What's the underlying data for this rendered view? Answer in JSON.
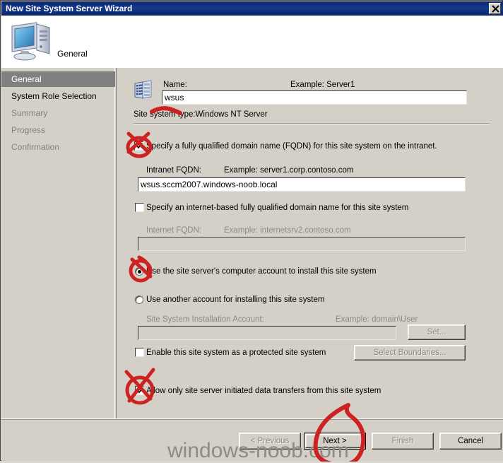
{
  "window": {
    "title": "New Site System Server Wizard",
    "close_label": "x"
  },
  "header": {
    "title": "General",
    "icon": "computer-server-icon"
  },
  "sidebar": {
    "items": [
      {
        "label": "General",
        "state": "active"
      },
      {
        "label": "System Role Selection",
        "state": "enabled"
      },
      {
        "label": "Summary",
        "state": "disabled"
      },
      {
        "label": "Progress",
        "state": "disabled"
      },
      {
        "label": "Confirmation",
        "state": "disabled"
      }
    ]
  },
  "main": {
    "name_label": "Name:",
    "name_example": "Example: Server1",
    "name_value": "wsus",
    "site_system_type": "Site system type:Windows NT Server",
    "fqdn_checkbox_label": "Specify a fully qualified domain name (FQDN) for this site system on the intranet.",
    "fqdn_checkbox_checked": true,
    "intranet_fqdn_label": "Intranet FQDN:",
    "intranet_fqdn_example": "Example: server1.corp.contoso.com",
    "intranet_fqdn_value": "wsus.sccm2007.windows-noob.local",
    "internet_checkbox_label": "Specify an internet-based fully qualified domain name for this site system",
    "internet_checkbox_checked": false,
    "internet_fqdn_label": "Internet FQDN:",
    "internet_fqdn_example": "Example: internetsrv2.contoso.com",
    "internet_fqdn_value": "",
    "radio_computer_account_label": "Use the site server's computer account to install this site system",
    "radio_computer_account_selected": true,
    "radio_another_account_label": "Use another account for installing this site system",
    "radio_another_account_selected": false,
    "install_account_label": "Site System Installation Account:",
    "install_account_example": "Example: domain\\User",
    "install_account_value": "",
    "set_button_label": "Set...",
    "protected_checkbox_label": "Enable this site system as a protected site system",
    "protected_checkbox_checked": false,
    "select_boundaries_button_label": "Select Boundaries...",
    "allow_transfers_checkbox_label": "Allow only site server initiated data transfers from this site system",
    "allow_transfers_checkbox_checked": true
  },
  "footer": {
    "previous_label": "< Previous",
    "next_label": "Next >",
    "finish_label": "Finish",
    "cancel_label": "Cancel"
  },
  "watermark": {
    "text": "windows-noob.com"
  },
  "colors": {
    "titlebar": "#14285f",
    "face": "#d4d0c8",
    "annotation_red": "#cc2222",
    "selection_gray": "#808080"
  }
}
